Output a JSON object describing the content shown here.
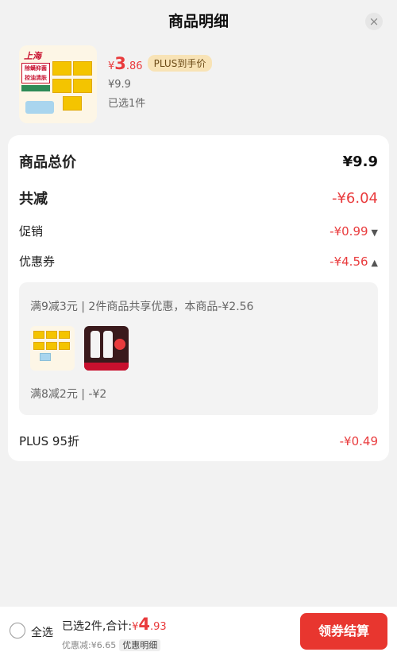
{
  "header": {
    "title": "商品明细",
    "close_icon": "×"
  },
  "product": {
    "currency": "¥",
    "price_int": "3",
    "price_dec": ".86",
    "badge": "PLUS到手价",
    "original_price": "¥9.9",
    "selected": "已选1件",
    "thumb_brand": "上海",
    "thumb_tag": "除螨抑菌 控油清肤"
  },
  "summary": {
    "total_label": "商品总价",
    "total_value": "¥9.9",
    "reduce_label": "共减",
    "reduce_value": "-¥6.04",
    "promo_label": "促销",
    "promo_value": "-¥0.99",
    "coupon_label": "优惠券",
    "coupon_value": "-¥4.56",
    "plus_label": "PLUS 95折",
    "plus_value": "-¥0.49"
  },
  "coupons": {
    "line1": "满9减3元 | 2件商品共享优惠，本商品-¥2.56",
    "line2": "满8减2元 | -¥2"
  },
  "footer": {
    "select_all": "全选",
    "sum_prefix": "已选2件,合计:",
    "sum_currency": "¥",
    "sum_int": "4",
    "sum_dec": ".93",
    "discount": "优惠减:¥6.65",
    "detail_button": "优惠明细",
    "checkout_button": "领券结算"
  },
  "colors": {
    "accent_red": "#e93b3d",
    "checkout_red": "#e8362f",
    "plus_badge_bg": "#f8e3b6"
  }
}
